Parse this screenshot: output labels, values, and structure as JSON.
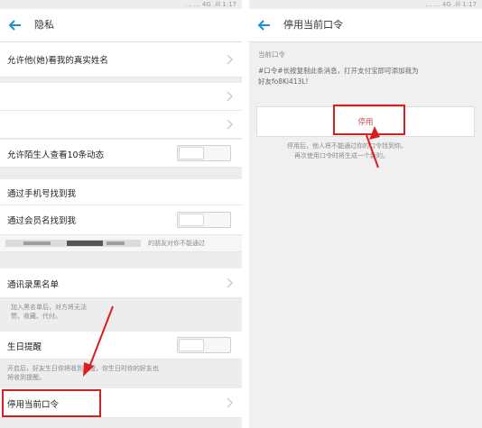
{
  "left": {
    "status_text": "… … 4G .ill 1:17",
    "title": "隐私",
    "rows": {
      "real_name": "允许他(她)看我的真实姓名",
      "stranger_ten": "允许陌生人查看10条动态",
      "find_by_phone": "通过手机号找到我",
      "find_by_member": "通过会员名找到我",
      "blacklist": "通讯录黑名单",
      "birthday": "生日提醒",
      "disable_code": "停用当前口令"
    },
    "notes": {
      "friends_hint": "的朋友对你不能通过",
      "blacklist_1": "加入黑名单后，对方将无法",
      "blacklist_2": "赞、收藏、代付。",
      "birthday_1": "开启后，好友生日你将收到提醒，你生日时你的好友也",
      "birthday_2": "将收到提醒。"
    }
  },
  "right": {
    "status_text": "… … 4G .ill 1:17",
    "title": "停用当前口令",
    "section_title": "当前口令",
    "code_line_1": "#口令#长按复制此条消息，打开支付宝即可添加我为",
    "code_line_2": "好友fo8Ki413L!",
    "disable_button": "停用",
    "info_1": "停用后，他人将不能通过你的口令找到你。",
    "info_2": "再次使用口令时将生成一个新的。"
  },
  "colors": {
    "highlight": "#d81e1e",
    "accent": "#1b8fd6"
  }
}
